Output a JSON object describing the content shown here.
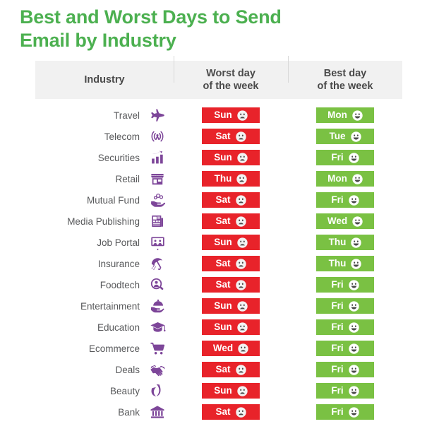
{
  "title": {
    "line1": "Best and Worst Days to Send",
    "line2": "Email by Industry",
    "color": "#4cb050"
  },
  "table": {
    "headers": {
      "industry": "Industry",
      "worst_line1": "Worst day",
      "worst_line2": "of the week",
      "best_line1": "Best day",
      "best_line2": "of the week"
    },
    "colors": {
      "header_background": "#f1f1f1",
      "worst_badge": "#e8232a",
      "best_badge": "#7ac143",
      "icon": "#7d4699",
      "label_text": "#58595b"
    },
    "rows": [
      {
        "industry": "Travel",
        "icon": "airplane-icon",
        "worst_day": "Sun",
        "best_day": "Mon",
        "worst_face": "sad-face-icon",
        "best_face": "happy-face-icon"
      },
      {
        "industry": "Telecom",
        "icon": "antenna-signal-icon",
        "worst_day": "Sat",
        "best_day": "Tue",
        "worst_face": "sad-face-icon",
        "best_face": "happy-face-icon"
      },
      {
        "industry": "Securities",
        "icon": "bar-chart-icon",
        "worst_day": "Sun",
        "best_day": "Fri",
        "worst_face": "sad-face-icon",
        "best_face": "happy-face-icon"
      },
      {
        "industry": "Retail",
        "icon": "storefront-icon",
        "worst_day": "Thu",
        "best_day": "Mon",
        "worst_face": "sad-face-icon",
        "best_face": "happy-face-icon"
      },
      {
        "industry": "Mutual Fund",
        "icon": "hand-coins-icon",
        "worst_day": "Sat",
        "best_day": "Fri",
        "worst_face": "sad-face-icon",
        "best_face": "happy-face-icon"
      },
      {
        "industry": "Media Publishing",
        "icon": "newspaper-icon",
        "worst_day": "Sat",
        "best_day": "Wed",
        "worst_face": "sad-face-icon",
        "best_face": "happy-face-icon"
      },
      {
        "industry": "Job Portal",
        "icon": "presentation-icon",
        "worst_day": "Sun",
        "best_day": "Thu",
        "worst_face": "sad-face-icon",
        "best_face": "happy-face-icon"
      },
      {
        "industry": "Insurance",
        "icon": "umbrella-rain-icon",
        "worst_day": "Sat",
        "best_day": "Thu",
        "worst_face": "sad-face-icon",
        "best_face": "happy-face-icon"
      },
      {
        "industry": "Foodtech",
        "icon": "magnifier-person-icon",
        "worst_day": "Sat",
        "best_day": "Fri",
        "worst_face": "sad-face-icon",
        "best_face": "happy-face-icon"
      },
      {
        "industry": "Entertainment",
        "icon": "serving-cloche-icon",
        "worst_day": "Sun",
        "best_day": "Fri",
        "worst_face": "sad-face-icon",
        "best_face": "happy-face-icon"
      },
      {
        "industry": "Education",
        "icon": "graduation-cap-icon",
        "worst_day": "Sun",
        "best_day": "Fri",
        "worst_face": "sad-face-icon",
        "best_face": "happy-face-icon"
      },
      {
        "industry": "Ecommerce",
        "icon": "shopping-cart-icon",
        "worst_day": "Wed",
        "best_day": "Fri",
        "worst_face": "sad-face-icon",
        "best_face": "happy-face-icon"
      },
      {
        "industry": "Deals",
        "icon": "handshake-icon",
        "worst_day": "Sat",
        "best_day": "Fri",
        "worst_face": "sad-face-icon",
        "best_face": "happy-face-icon"
      },
      {
        "industry": "Beauty",
        "icon": "leaf-drop-icon",
        "worst_day": "Sun",
        "best_day": "Fri",
        "worst_face": "sad-face-icon",
        "best_face": "happy-face-icon"
      },
      {
        "industry": "Bank",
        "icon": "bank-building-icon",
        "worst_day": "Sat",
        "best_day": "Fri",
        "worst_face": "sad-face-icon",
        "best_face": "happy-face-icon"
      }
    ]
  }
}
